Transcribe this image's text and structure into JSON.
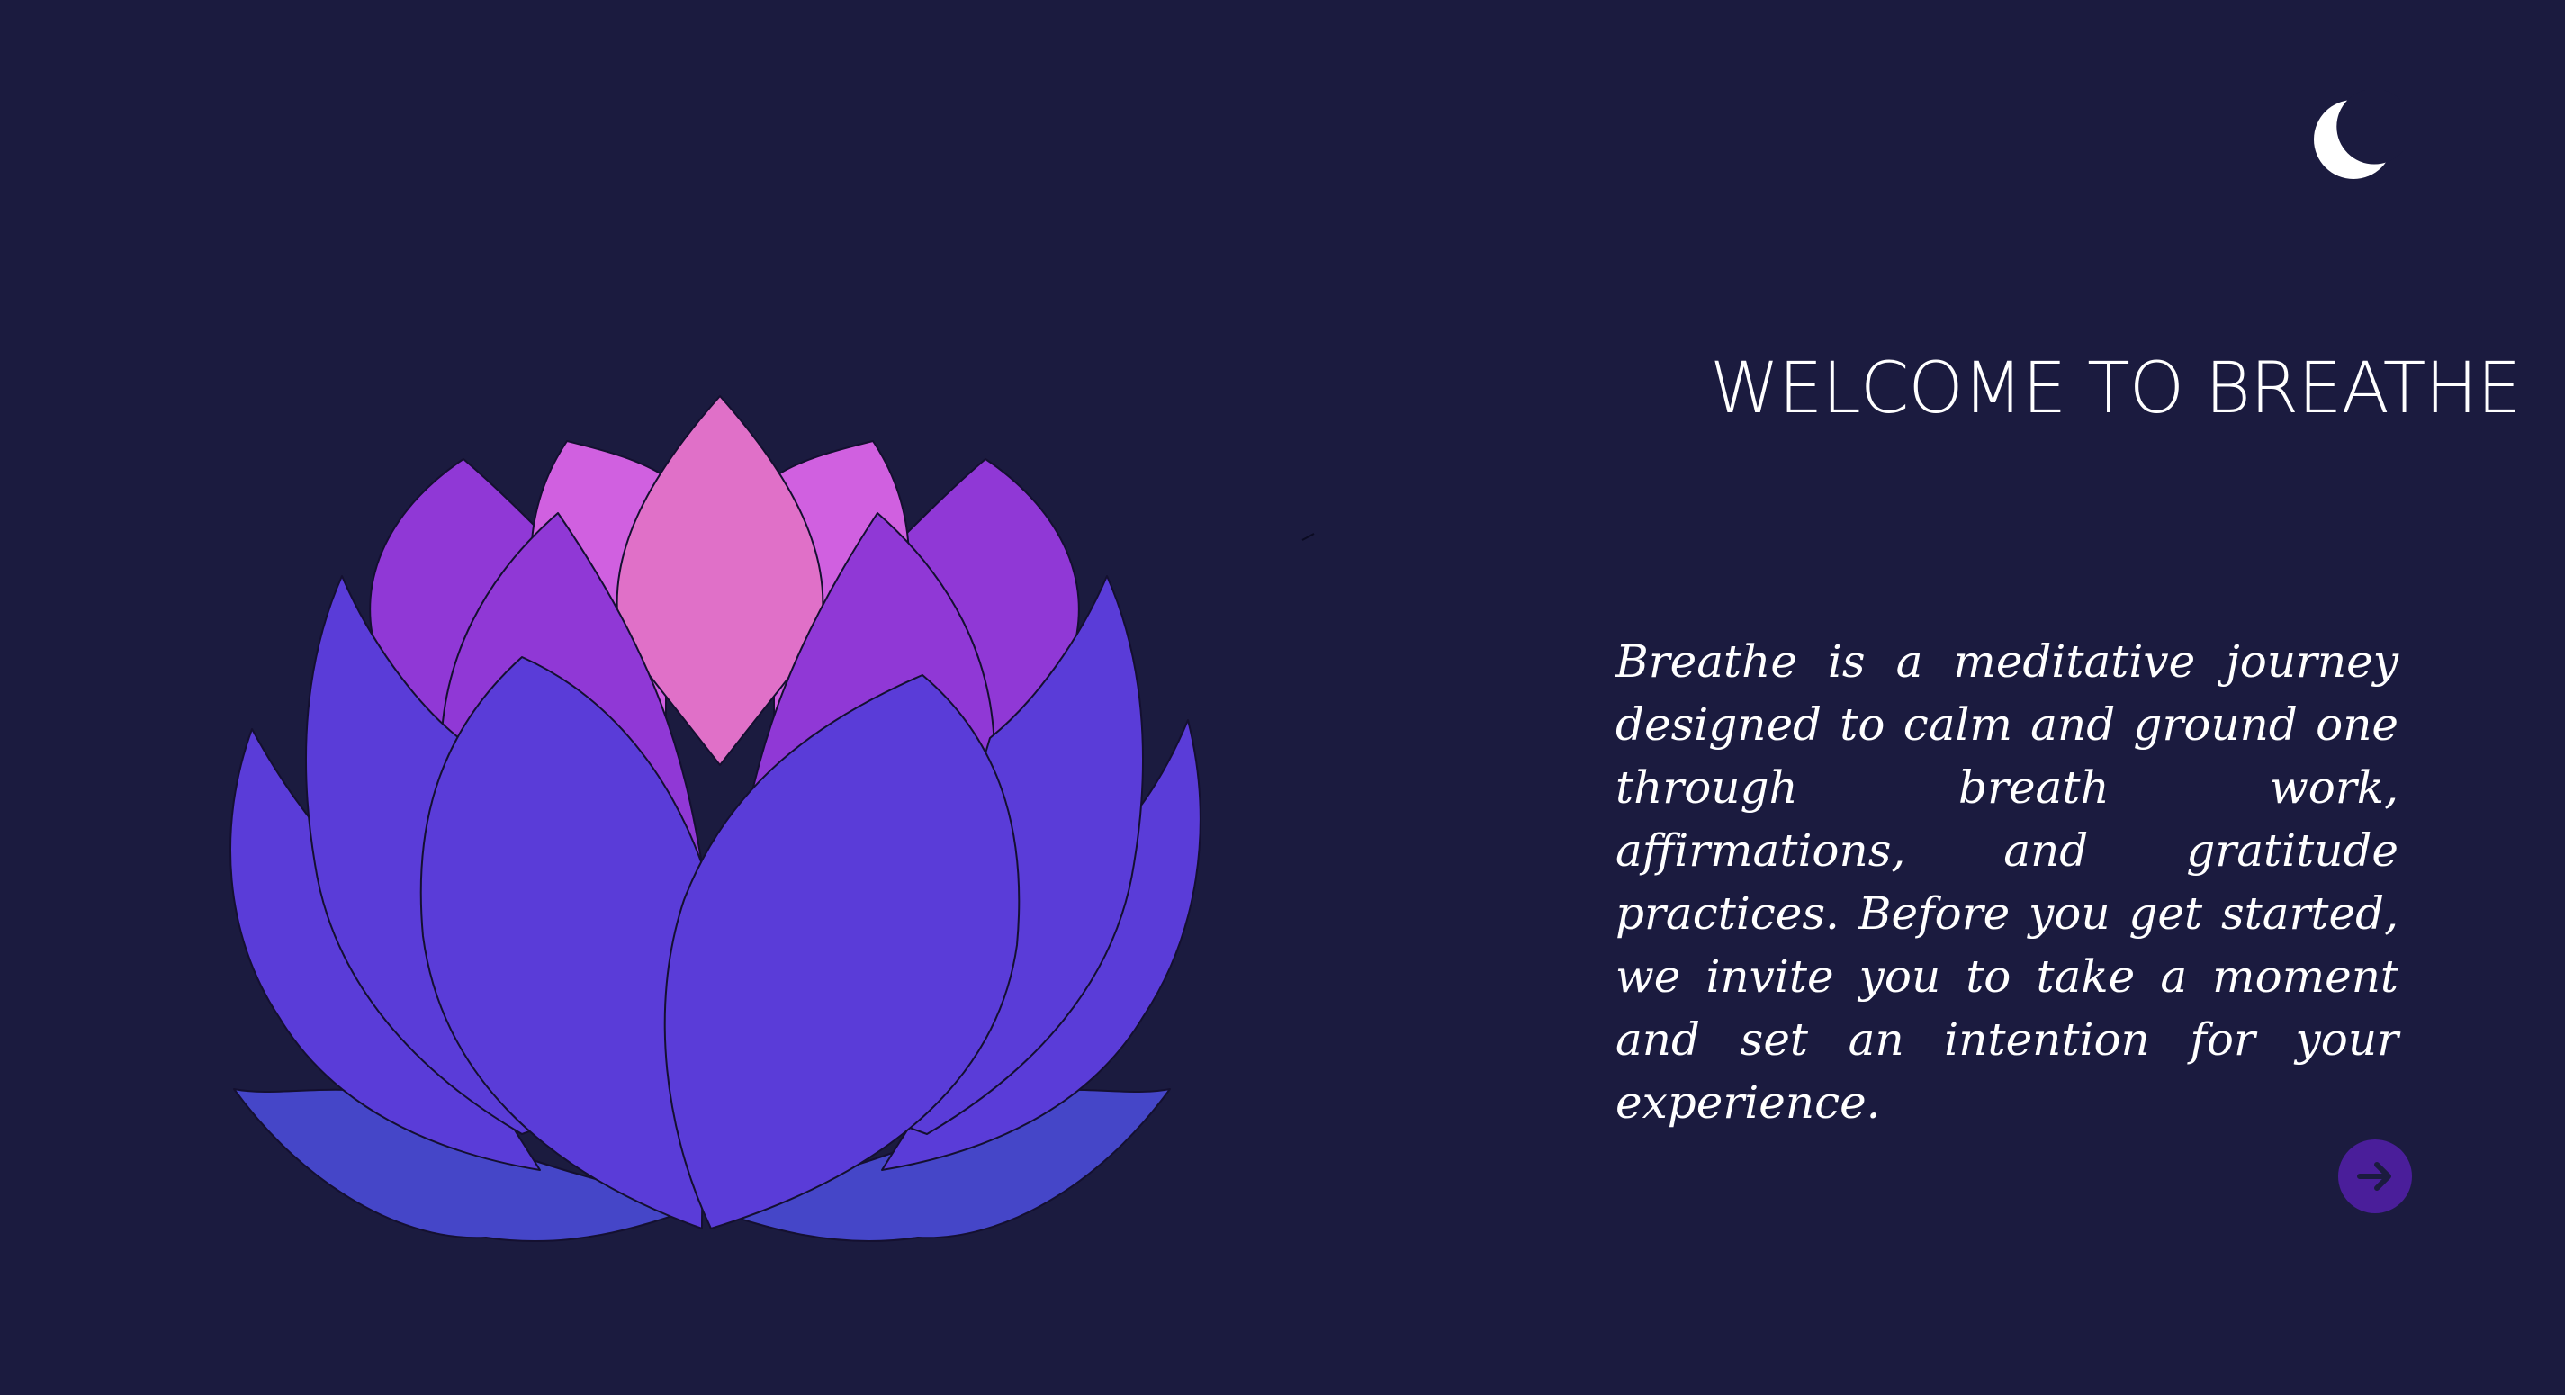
{
  "header": {
    "theme_toggle_icon": "moon-icon"
  },
  "welcome": {
    "title": "WELCOME TO BREATHE",
    "description": "Breathe is a meditative journey designed to calm and ground one through breath work, affirmations, and gratitude practices. Before you get started, we invite you to take a moment and set an intention for your experience."
  },
  "illustration": {
    "name": "lotus-flower"
  },
  "navigation": {
    "next_icon": "arrow-right-icon"
  },
  "colors": {
    "background": "#1b1b3f",
    "text": "#ffffff",
    "petal_outer": "#5a3cd8",
    "petal_middle": "#9038d6",
    "petal_inner": "#d060e0",
    "petal_center": "#e070c8",
    "leaf": "#4546c8",
    "button": "#4a1e9a"
  }
}
